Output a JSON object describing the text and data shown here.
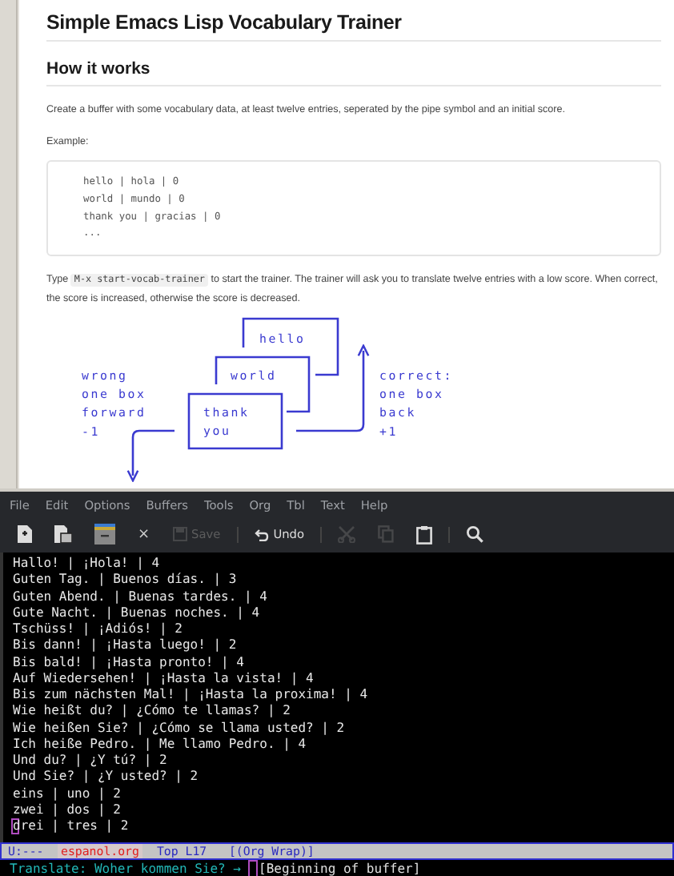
{
  "document": {
    "title": "Simple Emacs Lisp Vocabulary Trainer",
    "heading": "How it works",
    "intro": "Create a buffer with some vocabulary data, at least twelve entries, seperated by the pipe symbol and an initial score.",
    "example_label": "Example:",
    "code_lines": [
      "hello | hola | 0",
      "world | mundo | 0",
      "thank you | gracias | 0",
      "..."
    ],
    "instructions": {
      "before": "Type",
      "code": "M-x start-vocab-trainer",
      "after": "to start the trainer. The trainer will ask you to translate twelve entries with a low score. When correct, the score is increased, otherwise the score is decreased."
    },
    "diagram": {
      "cards": [
        [
          "hello"
        ],
        [
          "world"
        ],
        [
          "thank",
          "you"
        ]
      ],
      "wrong_label": [
        "wrong",
        "one box",
        "forward",
        "-1"
      ],
      "correct_label": [
        "correct:",
        "one box",
        "back",
        "+1"
      ]
    }
  },
  "emacs": {
    "menu": [
      "File",
      "Edit",
      "Options",
      "Buffers",
      "Tools",
      "Org",
      "Tbl",
      "Text",
      "Help"
    ],
    "toolbar": [
      {
        "kind": "new",
        "disabled": false
      },
      {
        "kind": "open",
        "disabled": false
      },
      {
        "kind": "dired",
        "disabled": false
      },
      {
        "kind": "close",
        "label": "×",
        "disabled": false
      },
      {
        "kind": "save",
        "label": "Save",
        "disabled": true
      },
      {
        "kind": "undo",
        "label": "Undo",
        "disabled": false
      },
      {
        "kind": "cut",
        "disabled": true
      },
      {
        "kind": "copy",
        "disabled": true
      },
      {
        "kind": "paste",
        "disabled": false
      },
      {
        "kind": "search",
        "disabled": false
      }
    ],
    "buffer_lines": [
      {
        "text": "Hallo! | ¡Hola! | 4",
        "cursor": false
      },
      {
        "text": "Guten Tag. | Buenos días. | 3",
        "cursor": false
      },
      {
        "text": "Guten Abend. | Buenas tardes. | 4",
        "cursor": false
      },
      {
        "text": "Gute Nacht. | Buenas noches. | 4",
        "cursor": false
      },
      {
        "text": "Tschüss! | ¡Adiós! | 2",
        "cursor": false
      },
      {
        "text": "Bis dann! | ¡Hasta luego! | 2",
        "cursor": false
      },
      {
        "text": "Bis bald! | ¡Hasta pronto! | 4",
        "cursor": false
      },
      {
        "text": "Auf Wiedersehen! | ¡Hasta la vista! | 4",
        "cursor": false
      },
      {
        "text": "Bis zum nächsten Mal! | ¡Hasta la proxima! | 4",
        "cursor": false
      },
      {
        "text": "Wie heißt du? | ¿Cómo te llamas? | 2",
        "cursor": false
      },
      {
        "text": "Wie heißen Sie? | ¿Cómo se llama usted? | 2",
        "cursor": false
      },
      {
        "text": "Ich heiße Pedro. | Me llamo Pedro. | 4",
        "cursor": false
      },
      {
        "text": "Und du? | ¿Y tú? | 2",
        "cursor": false
      },
      {
        "text": "Und Sie? | ¿Y usted? | 2",
        "cursor": false
      },
      {
        "text": "eins | uno | 2",
        "cursor": false
      },
      {
        "text": "zwei | dos | 2",
        "cursor": false
      },
      {
        "text": "drei | tres | 2",
        "cursor": true
      }
    ],
    "mode_line": {
      "status": "U:---",
      "buffer": "espanol.org",
      "position": "Top L17",
      "modes": "[(Org Wrap)]"
    },
    "minibuffer": {
      "prompt": "Translate: Woher kommen Sie? →",
      "message": "[Beginning of buffer]"
    }
  }
}
